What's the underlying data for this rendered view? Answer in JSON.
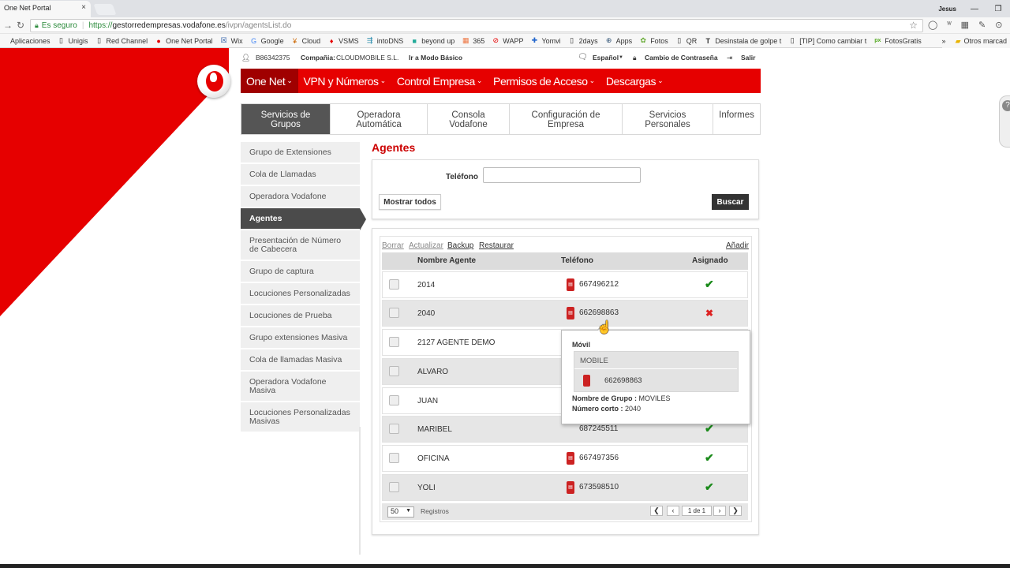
{
  "browser": {
    "tab_title": "One Net Portal",
    "tab_close": "×",
    "user": "Jesus",
    "secure_label": "Es seguro",
    "url_scheme": "https://",
    "url_host": "gestorredempresas.vodafone.es",
    "url_path": "/ivpn/agentsList.do",
    "bookmarks": [
      "Aplicaciones",
      "Unigis",
      "Red Channel",
      "One Net Portal",
      "Wix",
      "Google",
      "Cloud",
      "VSMS",
      "intoDNS",
      "beyond up",
      "365",
      "WAPP",
      "Yomvi",
      "2days",
      "Apps",
      "Fotos",
      "QR",
      "Desinstala de golpe t",
      "[TIP] Como cambiar t",
      "FotosGratis"
    ],
    "bookmarks_more": "»",
    "other_bookmarks": "Otros marcad"
  },
  "top_info": {
    "user_id": "B86342375",
    "company_label": "Compañia:",
    "company": "CLOUDMOBILE S.L.",
    "basic_mode": "Ir a Modo Básico",
    "language": "Español",
    "change_password": "Cambio de Contraseña",
    "logout": "Salir"
  },
  "main_menu": [
    {
      "label": "One Net"
    },
    {
      "label": "VPN y Números"
    },
    {
      "label": "Control Empresa"
    },
    {
      "label": "Permisos de Acceso"
    },
    {
      "label": "Descargas"
    }
  ],
  "sub_tabs": [
    {
      "label": "Servicios de Grupos"
    },
    {
      "label": "Operadora Automática"
    },
    {
      "label": "Consola Vodafone"
    },
    {
      "label": "Configuración de Empresa"
    },
    {
      "label": "Servicios Personales"
    },
    {
      "label": "Informes"
    }
  ],
  "sidebar": [
    {
      "label": "Grupo de Extensiones"
    },
    {
      "label": "Cola de Llamadas"
    },
    {
      "label": "Operadora Vodafone"
    },
    {
      "label": "Agentes"
    },
    {
      "label": "Presentación de Número de Cabecera"
    },
    {
      "label": "Grupo de captura"
    },
    {
      "label": "Locuciones Personalizadas"
    },
    {
      "label": "Locuciones de Prueba"
    },
    {
      "label": "Grupo extensiones Masiva"
    },
    {
      "label": "Cola de llamadas Masiva"
    },
    {
      "label": "Operadora Vodafone Masiva"
    },
    {
      "label": "Locuciones Personalizadas Masivas"
    }
  ],
  "page_title": "Agentes",
  "search": {
    "phone_label": "Teléfono",
    "phone_value": "",
    "show_all": "Mostrar todos",
    "search_button": "Buscar"
  },
  "grid": {
    "actions": {
      "delete": "Borrar",
      "update": "Actualizar",
      "backup": "Backup",
      "restore": "Restaurar",
      "add": "Añadir"
    },
    "columns": {
      "name": "Nombre Agente",
      "phone": "Teléfono",
      "assigned": "Asignado"
    },
    "rows": [
      {
        "name": "2014",
        "phone": "667496212",
        "assigned": "✔"
      },
      {
        "name": "2040",
        "phone": "662698863",
        "assigned": "✖"
      },
      {
        "name": "2127 AGENTE DEMO",
        "phone": "",
        "assigned": ""
      },
      {
        "name": "ALVARO",
        "phone": "",
        "assigned": ""
      },
      {
        "name": "JUAN",
        "phone": "",
        "assigned": ""
      },
      {
        "name": "MARIBEL",
        "phone": "687245511",
        "assigned": "✔"
      },
      {
        "name": "OFICINA",
        "phone": "667497356",
        "assigned": "✔"
      },
      {
        "name": "YOLI",
        "phone": "673598510",
        "assigned": "✔"
      }
    ],
    "page_size": "50",
    "records_label": "Registros",
    "page_info": "1 de 1"
  },
  "popup": {
    "title": "Móvil",
    "header": "MOBILE",
    "number": "662698863",
    "group_label": "Nombre de Grupo :",
    "group_value": "MOVILES",
    "short_label": "Número corto :",
    "short_value": "2040"
  },
  "colors": {
    "brand_red": "#e60000",
    "ok_green": "#1a8a1a",
    "error_red": "#d22222"
  }
}
